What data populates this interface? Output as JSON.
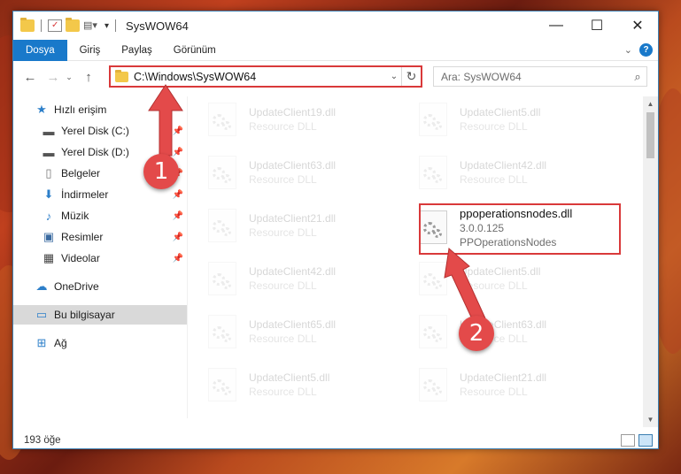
{
  "window": {
    "title": "SysWOW64",
    "controls": {
      "minimize": "—",
      "maximize": "☐",
      "close": "✕"
    }
  },
  "ribbon": {
    "tabs": [
      "Dosya",
      "Giriş",
      "Paylaş",
      "Görünüm"
    ],
    "expand_icon": "chevron-down-icon",
    "help_label": "?"
  },
  "address": {
    "path": "C:\\Windows\\SysWOW64",
    "search_placeholder": "Ara: SysWOW64"
  },
  "sidebar": {
    "items": [
      {
        "label": "Hızlı erişim",
        "icon": "star-icon",
        "pinned": false
      },
      {
        "label": "Yerel Disk (C:)",
        "icon": "drive-icon",
        "pinned": true
      },
      {
        "label": "Yerel Disk (D:)",
        "icon": "drive-icon",
        "pinned": true
      },
      {
        "label": "Belgeler",
        "icon": "document-icon",
        "pinned": true
      },
      {
        "label": "İndirmeler",
        "icon": "download-icon",
        "pinned": true
      },
      {
        "label": "Müzik",
        "icon": "music-icon",
        "pinned": true
      },
      {
        "label": "Resimler",
        "icon": "pictures-icon",
        "pinned": true
      },
      {
        "label": "Videolar",
        "icon": "video-icon",
        "pinned": true
      },
      {
        "label": "OneDrive",
        "icon": "cloud-icon",
        "pinned": false
      },
      {
        "label": "Bu bilgisayar",
        "icon": "computer-icon",
        "pinned": false,
        "selected": true
      },
      {
        "label": "Ağ",
        "icon": "network-icon",
        "pinned": false
      }
    ]
  },
  "files": {
    "left_column": [
      {
        "name": "UpdateClient19.dll",
        "type": "Resource DLL"
      },
      {
        "name": "UpdateClient63.dll",
        "type": "Resource DLL"
      },
      {
        "name": "UpdateClient21.dll",
        "type": "Resource DLL"
      },
      {
        "name": "UpdateClient42.dll",
        "type": "Resource DLL"
      },
      {
        "name": "UpdateClient65.dll",
        "type": "Resource DLL"
      },
      {
        "name": "UpdateClient5.dll",
        "type": "Resource DLL"
      }
    ],
    "right_column": [
      {
        "name": "UpdateClient5.dll",
        "type": "Resource DLL"
      },
      {
        "name": "UpdateClient42.dll",
        "type": "Resource DLL"
      },
      {
        "name": "UpdateClient5.dll",
        "type": "Resource DLL"
      },
      {
        "name": "UpdateClient63.dll",
        "type": "Resource DLL"
      },
      {
        "name": "UpdateClient21.dll",
        "type": "Resource DLL"
      }
    ],
    "highlighted": {
      "name": "ppoperationsnodes.dll",
      "version": "3.0.0.125",
      "description": "PPOperationsNodes"
    }
  },
  "status": {
    "item_count": "193 öğe"
  },
  "annotations": {
    "badge1": "1",
    "badge2": "2",
    "color": "#e34a4a"
  }
}
